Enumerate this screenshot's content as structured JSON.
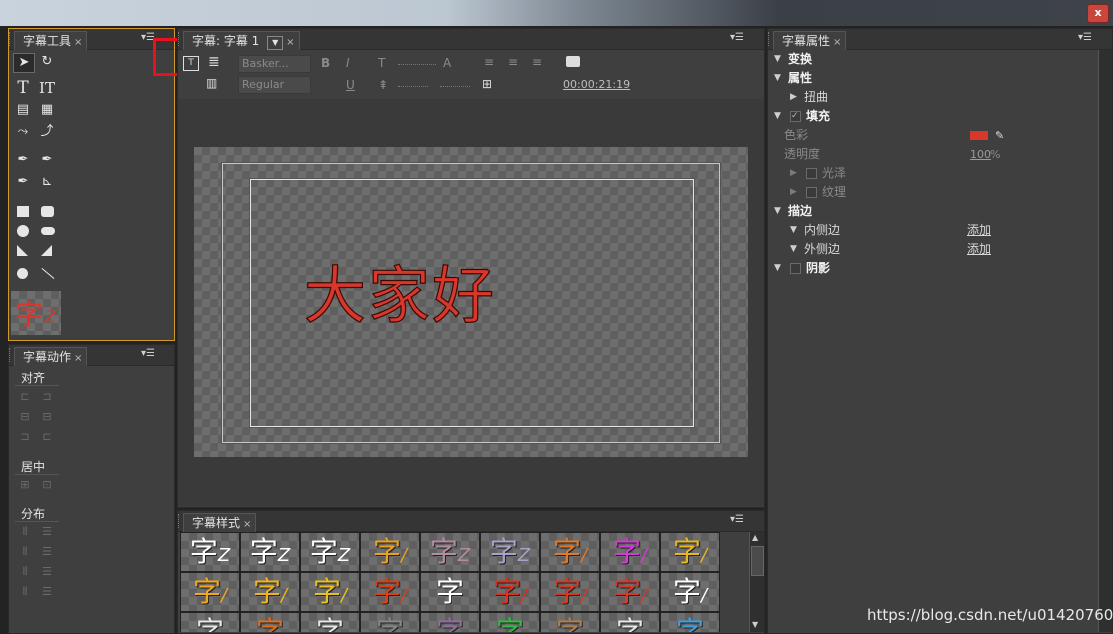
{
  "window": {
    "close_label": "x"
  },
  "tools_panel": {
    "tab_label": "字幕工具",
    "text_tool": "T",
    "vertical_text_tool": "IT",
    "preview_char": "字",
    "preview_suffix": "Z"
  },
  "actions_panel": {
    "tab_label": "字幕动作",
    "align_label": "对齐",
    "center_label": "居中",
    "distribute_label": "分布"
  },
  "title_panel": {
    "tab_label": "字幕: 字幕 1",
    "font_family": "Basker...",
    "font_style": "Regular",
    "timecode": "00:00:21:19",
    "canvas_text": "大家好",
    "text_color": "#d8372b"
  },
  "styles_panel": {
    "tab_label": "字幕样式",
    "row1": [
      {
        "text": "字",
        "suffix": "Z",
        "color": "#ffffff"
      },
      {
        "text": "字",
        "suffix": "Z",
        "color": "#ffffff"
      },
      {
        "text": "字",
        "suffix": "Z",
        "color": "#ffffff"
      },
      {
        "text": "字",
        "suffix": "/",
        "color": "#e9a21a"
      },
      {
        "text": "字",
        "suffix": "Z",
        "color": "#b48ca0"
      },
      {
        "text": "字",
        "suffix": "Z",
        "color": "#a8a2c8"
      },
      {
        "text": "字",
        "suffix": "/",
        "color": "#e07a2a"
      },
      {
        "text": "字",
        "suffix": "/",
        "color": "#d63ad6"
      },
      {
        "text": "字",
        "suffix": "/",
        "color": "#e8b81e"
      }
    ],
    "row2": [
      {
        "text": "字",
        "suffix": "/",
        "color": "#f0a81c"
      },
      {
        "text": "字",
        "suffix": "/",
        "color": "#f0b51c"
      },
      {
        "text": "字",
        "suffix": "/",
        "color": "#e8c020"
      },
      {
        "text": "字",
        "suffix": "/",
        "color": "#e04010"
      },
      {
        "text": "字",
        "suffix": "",
        "color": "#ffffff"
      },
      {
        "text": "字",
        "suffix": "/",
        "color": "#e0301c"
      },
      {
        "text": "字",
        "suffix": "/",
        "color": "#d83a20"
      },
      {
        "text": "字",
        "suffix": "/",
        "color": "#d83a2a"
      },
      {
        "text": "字",
        "suffix": "/",
        "color": "#ffffff"
      }
    ],
    "row3": [
      {
        "text": "字",
        "suffix": "",
        "color": "#e8e8e8"
      },
      {
        "text": "字",
        "suffix": "",
        "color": "#e07020"
      },
      {
        "text": "字",
        "suffix": "",
        "color": "#e8e8e8"
      },
      {
        "text": "字",
        "suffix": "",
        "color": "#888888"
      },
      {
        "text": "字",
        "suffix": "",
        "color": "#9070a0"
      },
      {
        "text": "字",
        "suffix": "",
        "color": "#30c040"
      },
      {
        "text": "字",
        "suffix": "",
        "color": "#b08050"
      },
      {
        "text": "字",
        "suffix": "",
        "color": "#e8e8e8"
      },
      {
        "text": "字",
        "suffix": "",
        "color": "#40a0e0"
      }
    ]
  },
  "properties_panel": {
    "tab_label": "字幕属性",
    "transform": "变换",
    "properties": "属性",
    "distort": "扭曲",
    "fill": "填充",
    "color_label": "色彩",
    "color_value": "#d8372b",
    "opacity_label": "透明度",
    "opacity_value": "100",
    "opacity_unit": "%",
    "sheen": "光泽",
    "texture": "纹理",
    "stroke": "描边",
    "inner_stroke": "内侧边",
    "outer_stroke": "外侧边",
    "add1": "添加",
    "add2": "添加",
    "shadow": "阴影"
  },
  "watermark": "https://blog.csdn.net/u014207606"
}
